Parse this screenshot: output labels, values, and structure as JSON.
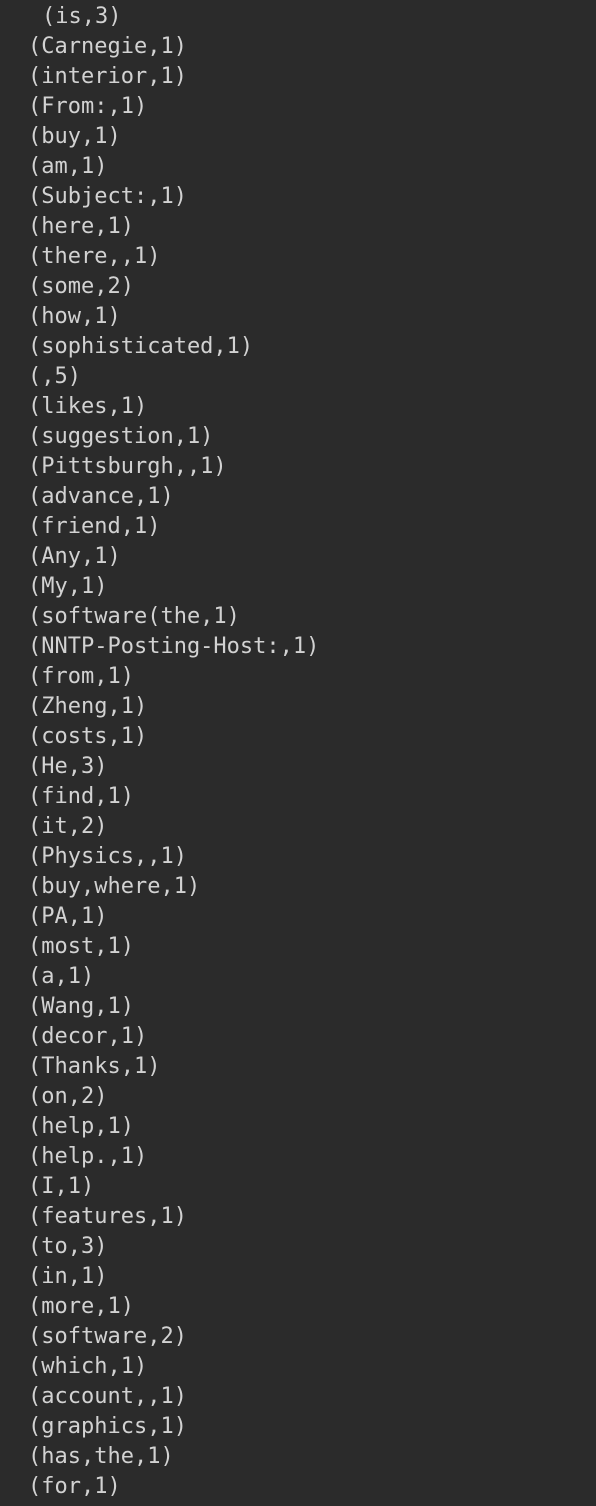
{
  "output": {
    "lines": [
      "(is,3)",
      "(Carnegie,1)",
      "(interior,1)",
      "(From:,1)",
      "(buy,1)",
      "(am,1)",
      "(Subject:,1)",
      "(here,1)",
      "(there,,1)",
      "(some,2)",
      "(how,1)",
      "(sophisticated,1)",
      "(,5)",
      "(likes,1)",
      "(suggestion,1)",
      "(Pittsburgh,,1)",
      "(advance,1)",
      "(friend,1)",
      "(Any,1)",
      "(My,1)",
      "(software(the,1)",
      "(NNTP-Posting-Host:,1)",
      "(from,1)",
      "(Zheng,1)",
      "(costs,1)",
      "(He,3)",
      "(find,1)",
      "(it,2)",
      "(Physics,,1)",
      "(buy,where,1)",
      "(PA,1)",
      "(most,1)",
      "(a,1)",
      "(Wang,1)",
      "(decor,1)",
      "(Thanks,1)",
      "(on,2)",
      "(help,1)",
      "(help.,1)",
      "(I,1)",
      "(features,1)",
      "(to,3)",
      "(in,1)",
      "(more,1)",
      "(software,2)",
      "(which,1)",
      "(account,,1)",
      "(graphics,1)",
      "(has,the,1)",
      "(for,1)"
    ]
  }
}
